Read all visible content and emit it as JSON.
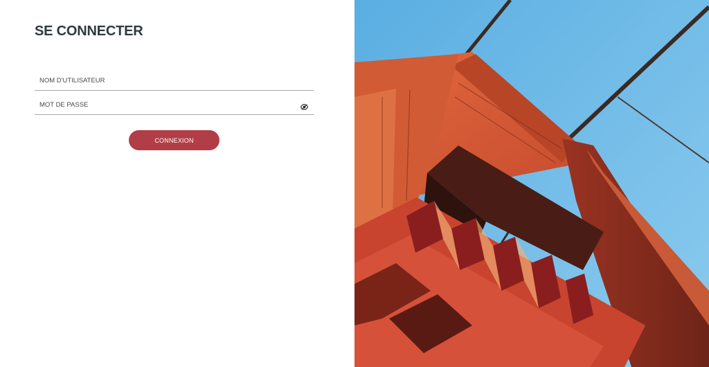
{
  "login": {
    "title": "SE CONNECTER",
    "username_placeholder": "NOM D'UTILISATEUR",
    "password_placeholder": "MOT DE PASSE",
    "submit_label": "CONNEXION",
    "show_password_icon": "eye-icon"
  },
  "colors": {
    "accent": "#b13e46",
    "title": "#2f3a3f",
    "field_border": "#a9a9a9"
  },
  "hero_image": {
    "subject": "bridge-tower-photo"
  }
}
